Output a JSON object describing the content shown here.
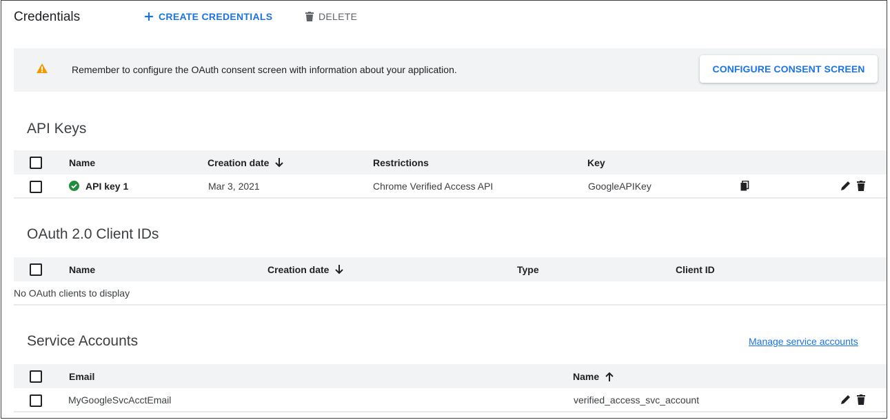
{
  "header": {
    "title": "Credentials",
    "create_label": "CREATE CREDENTIALS",
    "delete_label": "DELETE"
  },
  "banner": {
    "message": "Remember to configure the OAuth consent screen with information about your application.",
    "button_label": "CONFIGURE CONSENT SCREEN"
  },
  "api_keys": {
    "title": "API Keys",
    "columns": {
      "name": "Name",
      "creation_date": "Creation date",
      "restrictions": "Restrictions",
      "key": "Key"
    },
    "rows": [
      {
        "name": "API key 1",
        "creation_date": "Mar 3, 2021",
        "restrictions": "Chrome Verified Access API",
        "key": "GoogleAPIKey"
      }
    ]
  },
  "oauth": {
    "title": "OAuth 2.0 Client IDs",
    "columns": {
      "name": "Name",
      "creation_date": "Creation date",
      "type": "Type",
      "client_id": "Client ID"
    },
    "empty_message": "No OAuth clients to display"
  },
  "service_accounts": {
    "title": "Service Accounts",
    "manage_link": "Manage service accounts",
    "columns": {
      "email": "Email",
      "name": "Name"
    },
    "rows": [
      {
        "email": "MyGoogleSvcAcctEmail",
        "name": "verified_access_svc_account"
      }
    ]
  },
  "colors": {
    "accent": "#1a73e8",
    "warning": "#f29900",
    "success": "#1e8e3e"
  },
  "icons": [
    "add-icon",
    "trash-icon",
    "warning-icon",
    "arrow-down-icon",
    "check-circle-icon",
    "copy-icon",
    "pencil-icon",
    "arrow-up-icon"
  ]
}
